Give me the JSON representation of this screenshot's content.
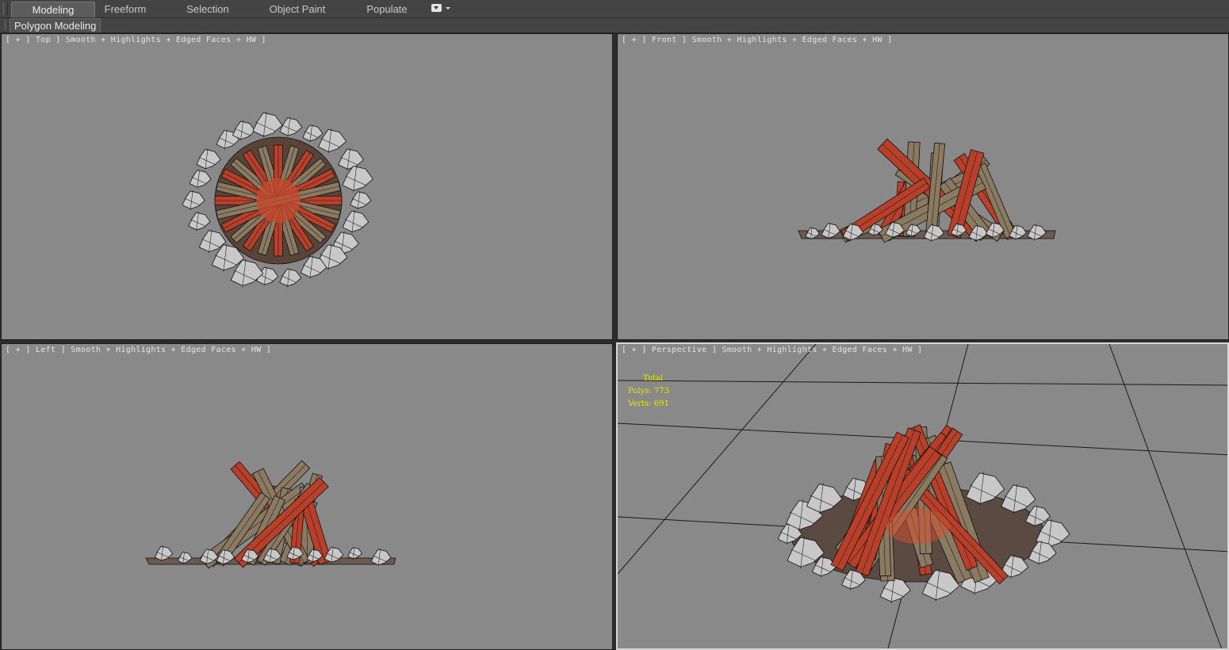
{
  "ribbon": {
    "tabs": [
      {
        "label": "Modeling",
        "active": true
      },
      {
        "label": "Freeform",
        "active": false
      },
      {
        "label": "Selection",
        "active": false
      },
      {
        "label": "Object Paint",
        "active": false
      },
      {
        "label": "Populate",
        "active": false
      }
    ],
    "panel_label": "Polygon Modeling"
  },
  "viewports": {
    "top": {
      "bracket_open": "[",
      "plus": "+",
      "sep1": "]",
      "view": "Top",
      "sep2": "]",
      "shading": "Smooth + Highlights + Edged Faces + HW",
      "bracket_close": "]"
    },
    "front": {
      "bracket_open": "[",
      "plus": "+",
      "sep1": "]",
      "view": "Front",
      "sep2": "]",
      "shading": "Smooth + Highlights + Edged Faces + HW",
      "bracket_close": "]"
    },
    "left": {
      "bracket_open": "[",
      "plus": "+",
      "sep1": "]",
      "view": "Left",
      "sep2": "]",
      "shading": "Smooth + Highlights + Edged Faces + HW",
      "bracket_close": "]"
    },
    "perspective": {
      "bracket_open": "[",
      "plus": "+",
      "sep1": "]",
      "view": "Perspective",
      "sep2": "]",
      "shading": "Smooth + Highlights + Edged Faces + HW",
      "bracket_close": "]"
    }
  },
  "stats": {
    "header": "Total",
    "polys_label": "Polys:",
    "polys_value": "773",
    "verts_label": "Verts:",
    "verts_value": "691"
  },
  "colors": {
    "viewport_bg": "#898989",
    "active_border": "#d8d8d8",
    "stats_text": "#e8e800",
    "ember": "#b8402a",
    "wood": "#8a7a62",
    "stone": "#c8c8c8"
  }
}
